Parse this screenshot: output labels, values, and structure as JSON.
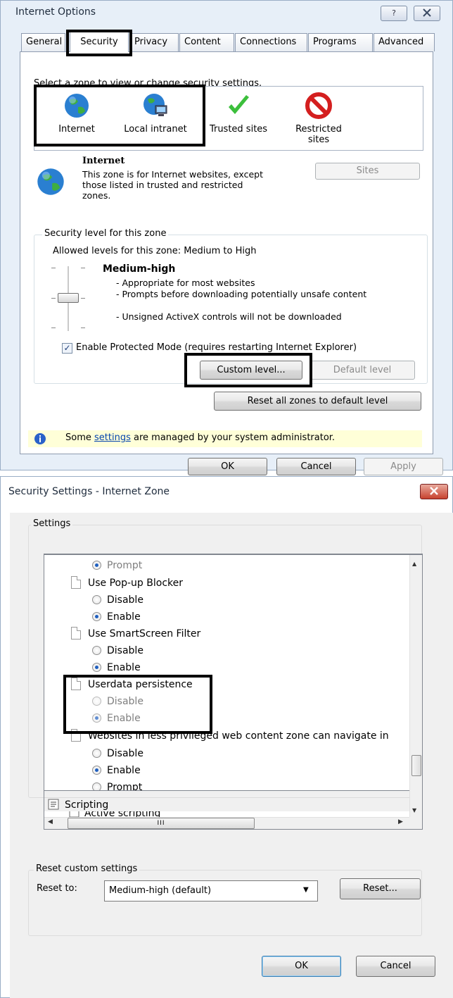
{
  "internet_options": {
    "title": "Internet Options",
    "help_button": "?",
    "tabs": [
      "General",
      "Security",
      "Privacy",
      "Content",
      "Connections",
      "Programs",
      "Advanced"
    ],
    "active_tab": "Security",
    "zone_prompt": "Select a zone to view or change security settings.",
    "zones": [
      {
        "label": "Internet",
        "icon": "globe-icon"
      },
      {
        "label": "Local intranet",
        "icon": "intranet-globe-icon"
      },
      {
        "label": "Trusted sites",
        "icon": "green-checkmark-icon"
      },
      {
        "label": "Restricted sites",
        "icon": "red-prohibited-icon"
      }
    ],
    "selected_zone": {
      "name": "Internet",
      "description": "This zone is for Internet websites, except those listed in trusted and restricted zones."
    },
    "sites_button": "Sites",
    "security_level": {
      "group_label": "Security level for this zone",
      "allowed_levels": "Allowed levels for this zone: Medium to High",
      "level_name": "Medium-high",
      "bullets": [
        "- Appropriate for most websites",
        "- Prompts before downloading potentially unsafe content",
        "- Unsigned ActiveX controls will not be downloaded"
      ]
    },
    "protected_mode": {
      "label": "Enable Protected Mode (requires restarting Internet Explorer)",
      "checked": true
    },
    "custom_level_button": "Custom level...",
    "default_level_button": "Default level",
    "reset_all_button": "Reset all zones to default level",
    "admin_notice": {
      "before": "Some",
      "link": "settings",
      "after": "are managed by your system administrator."
    },
    "ok_button": "OK",
    "cancel_button": "Cancel",
    "apply_button": "Apply"
  },
  "security_settings": {
    "title": "Security Settings - Internet Zone",
    "close_icon": "close-x-icon",
    "settings_group": "Settings",
    "tree": [
      {
        "type": "radio",
        "label": "Prompt",
        "checked": true
      },
      {
        "type": "doc",
        "label": "Use Pop-up Blocker"
      },
      {
        "type": "radio",
        "label": "Disable",
        "checked": false
      },
      {
        "type": "radio",
        "label": "Enable",
        "checked": true
      },
      {
        "type": "doc",
        "label": "Use SmartScreen Filter"
      },
      {
        "type": "radio",
        "label": "Disable",
        "checked": false
      },
      {
        "type": "radio",
        "label": "Enable",
        "checked": true
      },
      {
        "type": "doc",
        "label": "Userdata persistence"
      },
      {
        "type": "radio",
        "label": "Disable",
        "checked": false,
        "disabled": true
      },
      {
        "type": "radio",
        "label": "Enable",
        "checked": true,
        "disabled": true
      },
      {
        "type": "doc",
        "label": "Websites in less privileged web content zone can navigate in"
      },
      {
        "type": "radio",
        "label": "Disable",
        "checked": false
      },
      {
        "type": "radio",
        "label": "Enable",
        "checked": true
      },
      {
        "type": "radio",
        "label": "Prompt",
        "checked": false
      },
      {
        "type": "folder",
        "label": "Scripting"
      },
      {
        "type": "subfolder",
        "label": "Active scripting"
      }
    ],
    "hscroll_grip": "III",
    "reset_group": "Reset custom settings",
    "reset_to_label": "Reset to:",
    "reset_to_value": "Medium-high (default)",
    "reset_button": "Reset...",
    "ok_button": "OK",
    "cancel_button": "Cancel"
  }
}
